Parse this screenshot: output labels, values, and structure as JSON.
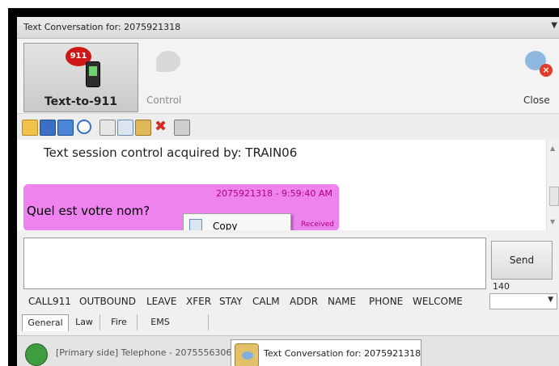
{
  "window": {
    "title": "Text Conversation for: 2075921318"
  },
  "toolbar_main": {
    "text911_label": "Text-to-911",
    "badge_911": "911",
    "control_label": "Control",
    "close_label": "Close"
  },
  "toolbar_icons": [
    "folder-open-icon",
    "save-icon",
    "save-as-icon",
    "undo-icon",
    "cut-icon",
    "copy-icon",
    "paste-icon",
    "delete-icon",
    "print-icon"
  ],
  "history": {
    "system_message": "Text session control acquired by: TRAIN06",
    "message": {
      "meta": "2075921318 - 9:59:40 AM",
      "text": "Quel est votre nom?",
      "status": "Received",
      "bubble_color": "#ee82ee"
    },
    "context_menu": {
      "copy_label": "Copy"
    }
  },
  "compose": {
    "send_label": "Send",
    "char_count": "140"
  },
  "quick_words": [
    "CALL911",
    "OUTBOUND",
    "LEAVE",
    "XFER",
    "STAY",
    "CALM",
    "ADDR",
    "NAME",
    "PHONE",
    "WELCOME"
  ],
  "category_tabs": [
    {
      "label": "General",
      "active": true
    },
    {
      "label": "Law",
      "active": false
    },
    {
      "label": "Fire",
      "active": false
    },
    {
      "label": "EMS",
      "active": false
    }
  ],
  "panel_tabs": [
    {
      "label": "[Primary side] Telephone - 2075556306",
      "active": false
    },
    {
      "label": "Text Conversation for: 2075921318",
      "active": true
    }
  ]
}
